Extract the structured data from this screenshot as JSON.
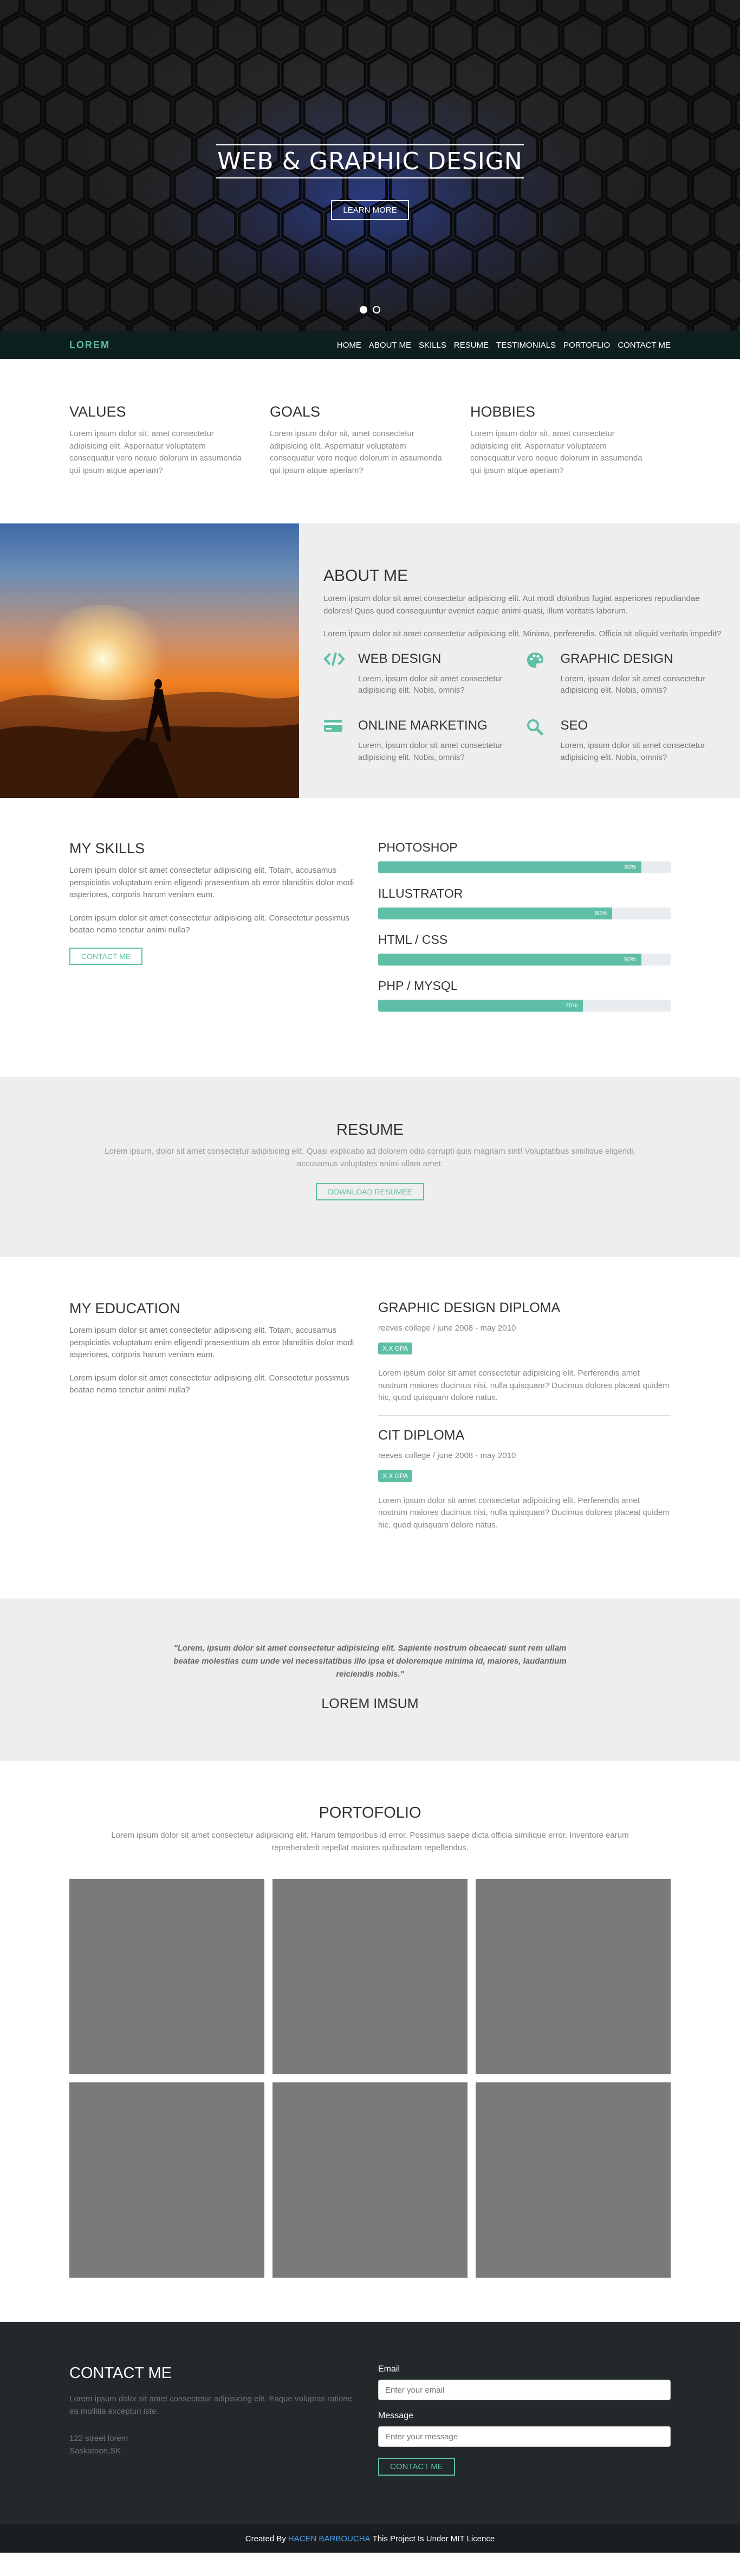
{
  "hero": {
    "title": "WEB & GRAPHIC DESIGN",
    "button": "LEARN MORE",
    "slides": 2
  },
  "nav": {
    "brand": "LOREM",
    "items": [
      "HOME",
      "ABOUT ME",
      "SKILLS",
      "RESUME",
      "TESTIMONIALS",
      "PORTOFLIO",
      "CONTACT ME"
    ]
  },
  "values": [
    {
      "title": "VALUES",
      "text": "Lorem ipsum dolor sit, amet consectetur adipisicing elit. Aspernatur voluptatem consequatur vero neque dolorum in assumenda qui ipsum atque aperiam?"
    },
    {
      "title": "GOALS",
      "text": "Lorem ipsum dolor sit, amet consectetur adipisicing elit. Aspernatur voluptatem consequatur vero neque dolorum in assumenda qui ipsum atque aperiam?"
    },
    {
      "title": "HOBBIES",
      "text": "Lorem ipsum dolor sit, amet consectetur adipisicing elit. Aspernatur voluptatem consequatur vero neque dolorum in assumenda qui ipsum atque aperiam?"
    }
  ],
  "about": {
    "title": "ABOUT ME",
    "p1": "Lorem ipsum dolor sit amet consectetur adipisicing elit. Aut modi doloribus fugiat asperiores repudiandae dolores! Quos quod consequuntur eveniet eaque animi quasi, illum veritatis laborum.",
    "p2": "Lorem ipsum dolor sit amet consectetur adipisicing elit. Minima, perferendis. Officia sit aliquid veritatis impedit?",
    "services": [
      {
        "icon": "code-icon",
        "title": "WEB DESIGN",
        "text": "Lorem, ipsum dolor sit amet consectetur adipisicing elit. Nobis, omnis?"
      },
      {
        "icon": "palette-icon",
        "title": "GRAPHIC DESIGN",
        "text": "Lorem, ipsum dolor sit amet consectetur adipisicing elit. Nobis, omnis?"
      },
      {
        "icon": "credit-card-icon",
        "title": "ONLINE MARKETING",
        "text": "Lorem, ipsum dolor sit amet consectetur adipisicing elit. Nobis, omnis?"
      },
      {
        "icon": "search-icon",
        "title": "SEO",
        "text": "Lorem, ipsum dolor sit amet consectetur adipisicing elit. Nobis, omnis?"
      }
    ]
  },
  "skills": {
    "title": "MY SKILLS",
    "p1": "Lorem ipsum dolor sit amet consectetur adipisicing elit. Totam, accusamus perspiciatis voluptatum enim eligendi praesentium ab error blanditiis dolor modi asperiores, corporis harum veniam eum.",
    "p2": "Lorem ipsum dolor sit amet consectetur adipisicing elit. Consectetur possimus beatae nemo tenetur animi nulla?",
    "button": "CONTACT ME",
    "items": [
      {
        "name": "PHOTOSHOP",
        "value": 90,
        "label": "90%"
      },
      {
        "name": "ILLUSTRATOR",
        "value": 80,
        "label": "80%"
      },
      {
        "name": "HTML / CSS",
        "value": 90,
        "label": "90%"
      },
      {
        "name": "PHP / MYSQL",
        "value": 70,
        "label": "70%"
      }
    ]
  },
  "resume": {
    "title": "RESUME",
    "text": "Lorem ipsum, dolor sit amet consectetur adipisicing elit. Quasi explicabo ad dolorem odio corrupti quis magnam sint! Voluptatibus similique eligendi, accusamus voluptates animi ullam amet.",
    "button": "DOWNLOAD RESUMEE"
  },
  "education": {
    "title": "MY EDUCATION",
    "p1": "Lorem ipsum dolor sit amet consectetur adipisicing elit. Totam, accusamus perspiciatis voluptatum enim eligendi praesentium ab error blanditiis dolor modi asperiores, corporis harum veniam eum.",
    "p2": "Lorem ipsum dolor sit amet consectetur adipisicing elit. Consectetur possimus beatae nemo tenetur animi nulla?",
    "diplomas": [
      {
        "title": "GRAPHIC DESIGN DIPLOMA",
        "meta": "reeves college / june 2008 - may 2010",
        "gpa": "X.X GPA",
        "text": "Lorem ipsum dolor sit amet consectetur adipisicing elit. Perferendis amet nostrum maiores ducimus nisi, nulla quisquam? Ducimus dolores placeat quidem hic, quod quisquam dolore natus."
      },
      {
        "title": "CIT DIPLOMA",
        "meta": "reeves college / june 2008 - may 2010",
        "gpa": "X.X GPA",
        "text": "Lorem ipsum dolor sit amet consectetur adipisicing elit. Perferendis amet nostrum maiores ducimus nisi, nulla quisquam? Ducimus dolores placeat quidem hic, quod quisquam dolore natus."
      }
    ]
  },
  "testimonial": {
    "quote": "\"Lorem, ipsum dolor sit amet consectetur adipisicing elit. Sapiente nostrum obcaecati sunt rem ullam beatae molestias cum unde vel necessitatibus illo ipsa et doloremque minima id, maiores, laudantium reiciendis nobis.\"",
    "author": "LOREM IMSUM"
  },
  "portfolio": {
    "title": "PORTOFOLIO",
    "text": "Lorem ipsum dolor sit amet consectetur adipisicing elit. Harum temporibus id error. Possimus saepe dicta officia similique error. Inventore earum reprehenderit repellat maiores quibusdam repellendus.",
    "tiles": 6
  },
  "contact": {
    "title": "CONTACT ME",
    "text": "Lorem ipsum dolor sit amet consectetur adipisicing elit. Eaque voluptas ratione ea mollitia excepturi iste.",
    "addr1": "122 street lorem",
    "addr2": "Saskatoon,SK",
    "email_label": "Email",
    "email_placeholder": "Enter your email",
    "message_label": "Message",
    "message_placeholder": "Enter your message",
    "button": "CONTACT ME"
  },
  "footer": {
    "prefix": "Created By",
    "author": "HACEN BARBOUCHA",
    "suffix": "This Project Is Under MIT Licence"
  },
  "colors": {
    "accent": "#5fbfa6",
    "nav_bg": "#0d1f1f",
    "contact_bg": "#23282b",
    "footer_link": "#4a9ff0"
  }
}
